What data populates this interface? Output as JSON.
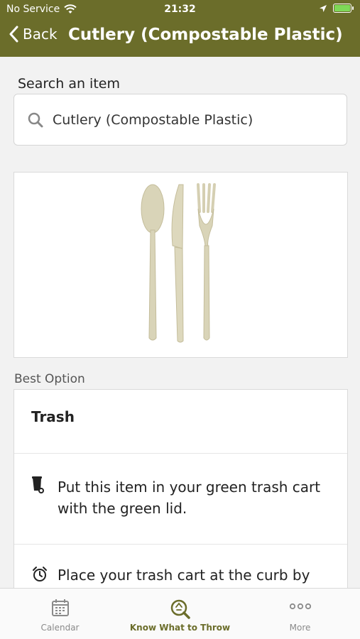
{
  "status_bar": {
    "carrier": "No Service",
    "time": "21:32"
  },
  "nav": {
    "back_label": "Back",
    "title": "Cutlery (Compostable Plastic)"
  },
  "search": {
    "label": "Search an item",
    "value": "Cutlery (Compostable Plastic)"
  },
  "best_option": {
    "section_label": "Best Option",
    "title": "Trash",
    "instructions": [
      {
        "icon": "trash-cart-icon",
        "line1": "Put this item in your green trash cart",
        "line2": "with the green lid."
      },
      {
        "icon": "alarm-clock-icon",
        "line1": "Place your trash cart at the curb by"
      }
    ]
  },
  "tabs": [
    {
      "label": "Calendar",
      "icon": "calendar-icon",
      "active": false
    },
    {
      "label": "Know What to Throw",
      "icon": "search-recycle-icon",
      "active": true
    },
    {
      "label": "More",
      "icon": "more-dots-icon",
      "active": false
    }
  ],
  "colors": {
    "brand": "#6b6d2a",
    "background": "#f2f2f2",
    "card": "#ffffff"
  }
}
